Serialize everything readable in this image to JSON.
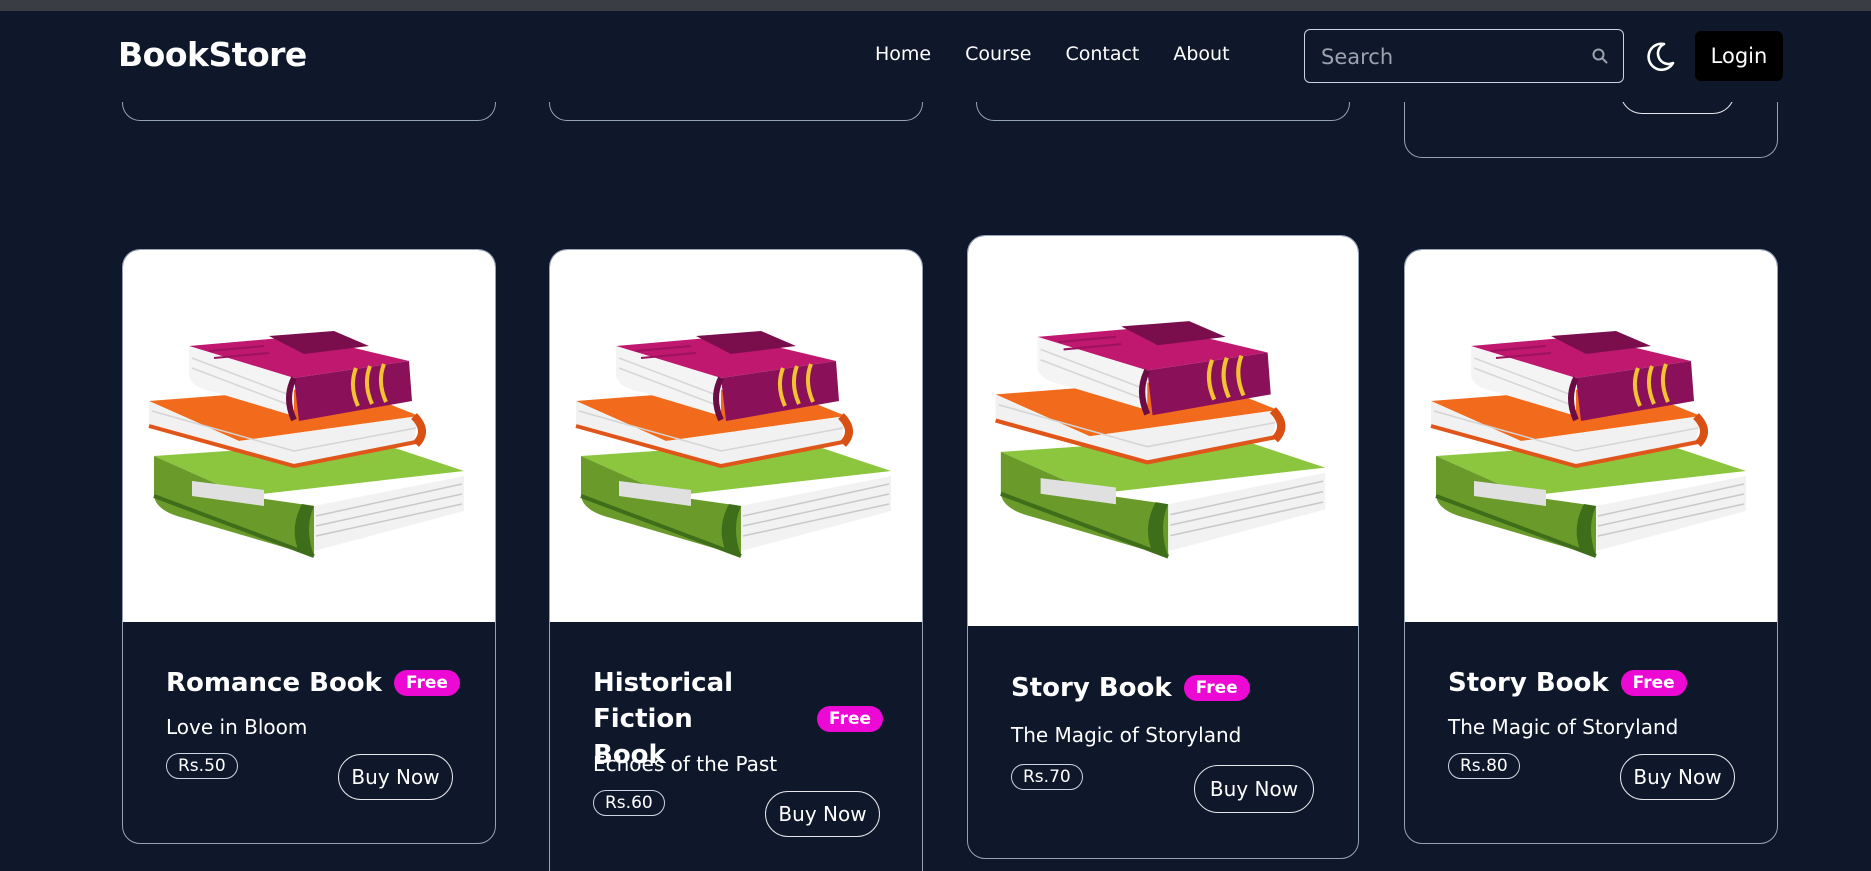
{
  "app": {
    "brand": "BookStore"
  },
  "nav": {
    "links": [
      "Home",
      "Course",
      "Contact",
      "About"
    ],
    "search_placeholder": "Search",
    "login_label": "Login"
  },
  "cards": [
    {
      "title": "Romance Book",
      "badge": "Free",
      "subtitle": "Love in Bloom",
      "price": "Rs.50",
      "buy": "Buy Now"
    },
    {
      "title": "Historical Fiction Book",
      "badge": "Free",
      "subtitle": "Echoes of the Past",
      "price": "Rs.60",
      "buy": "Buy Now"
    },
    {
      "title": "Story Book",
      "badge": "Free",
      "subtitle": "The Magic of Storyland",
      "price": "Rs.70",
      "buy": "Buy Now"
    },
    {
      "title": "Story Book",
      "badge": "Free",
      "subtitle": "The Magic of Storyland",
      "price": "Rs.80",
      "buy": "Buy Now"
    }
  ],
  "colors": {
    "background": "#0f172a",
    "badge": "#ec09d4",
    "login_bg": "#000000"
  },
  "icons": {
    "search": "search-icon",
    "theme": "moon-icon",
    "book": "books-stack-icon"
  }
}
